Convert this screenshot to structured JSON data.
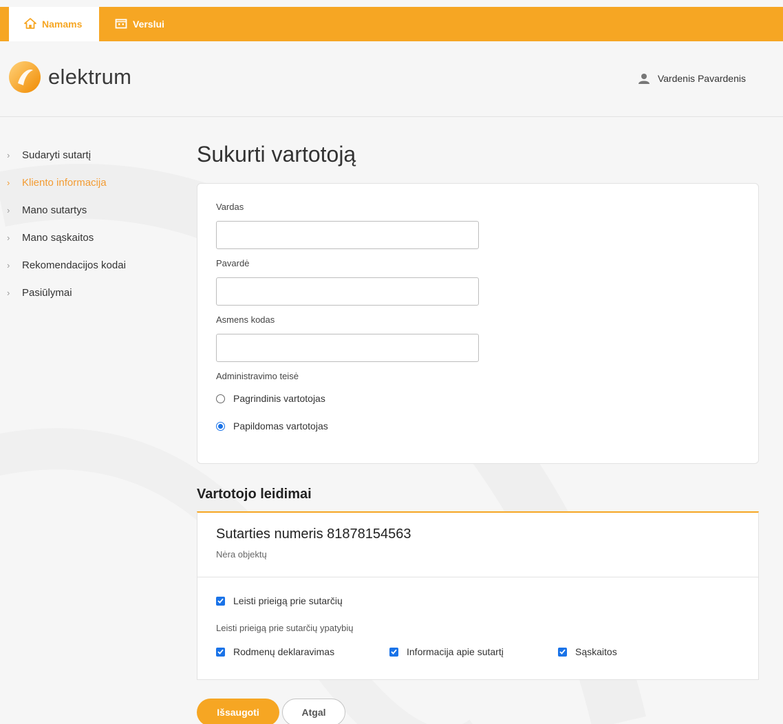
{
  "topbar": {
    "tabs": [
      {
        "label": "Namams",
        "icon": "home-icon",
        "active": true
      },
      {
        "label": "Verslui",
        "icon": "building-icon",
        "active": false
      }
    ],
    "accent_color": "#f6a623"
  },
  "header": {
    "logo_text": "elektrum",
    "user_name": "Vardenis Pavardenis"
  },
  "sidebar": {
    "items": [
      {
        "label": "Sudaryti sutartį",
        "active": false
      },
      {
        "label": "Kliento informacija",
        "active": true
      },
      {
        "label": "Mano sutartys",
        "active": false
      },
      {
        "label": "Mano sąskaitos",
        "active": false
      },
      {
        "label": "Rekomendacijos kodai",
        "active": false
      },
      {
        "label": "Pasiūlymai",
        "active": false
      }
    ]
  },
  "form": {
    "title": "Sukurti vartotoją",
    "fields": [
      {
        "label": "Vardas",
        "value": ""
      },
      {
        "label": "Pavardė",
        "value": ""
      },
      {
        "label": "Asmens kodas",
        "value": ""
      }
    ],
    "admin_label": "Administravimo teisė",
    "radios": [
      {
        "label": "Pagrindinis vartotojas",
        "checked": false
      },
      {
        "label": "Papildomas vartotojas",
        "checked": true
      }
    ]
  },
  "permissions": {
    "section_title": "Vartotojo leidimai",
    "contract_number": "Sutarties numeris 81878154563",
    "no_objects": "Nėra objektų",
    "allow_contracts": "Leisti prieigą prie sutarčių",
    "allow_features_label": "Leisti prieigą prie sutarčių ypatybių",
    "features": [
      {
        "label": "Rodmenų deklaravimas",
        "checked": true
      },
      {
        "label": "Informacija apie sutartį",
        "checked": true
      },
      {
        "label": "Sąskaitos",
        "checked": true
      }
    ]
  },
  "actions": {
    "save_label": "Išsaugoti",
    "back_label": "Atgal"
  }
}
